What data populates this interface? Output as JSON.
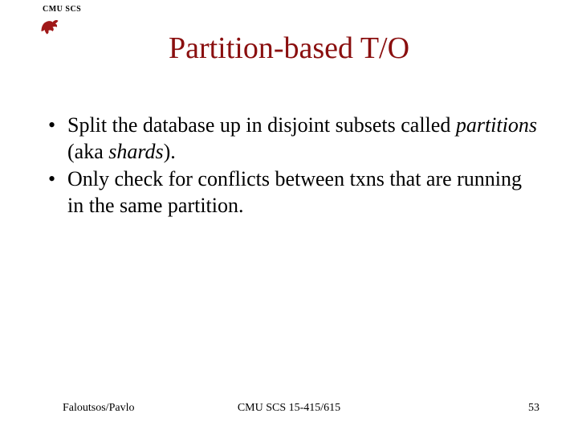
{
  "header": {
    "org_label": "CMU SCS"
  },
  "title": "Partition-based T/O",
  "bullets": [
    {
      "pre": "Split the database up in disjoint subsets called ",
      "it1": "partitions",
      "mid": " (aka ",
      "it2": "shards",
      "post": ")."
    },
    {
      "pre": "Only check for conflicts between txns that are running in the same partition.",
      "it1": "",
      "mid": "",
      "it2": "",
      "post": ""
    }
  ],
  "footer": {
    "left": "Faloutsos/Pavlo",
    "center": "CMU SCS 15-415/615",
    "right": "53"
  },
  "colors": {
    "title": "#8a0f0f",
    "logo": "#a01818"
  }
}
